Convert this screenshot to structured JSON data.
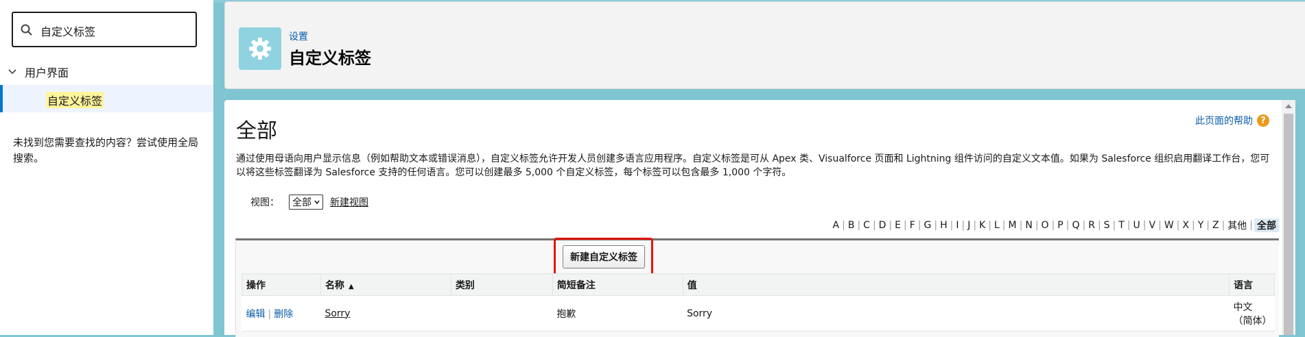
{
  "sidebar": {
    "search_value": "自定义标签",
    "tree_parent": "用户界面",
    "tree_child": "自定义标签",
    "not_found": "未找到您需要查找的内容？尝试使用全局搜索。"
  },
  "header": {
    "breadcrumb": "设置",
    "title": "自定义标签"
  },
  "main": {
    "heading": "全部",
    "help_link": "此页面的帮助",
    "help_icon": "?",
    "description": "通过使用母语向用户显示信息（例如帮助文本或错误消息），自定义标签允许开发人员创建多语言应用程序。自定义标签是可从 Apex 类、Visualforce 页面和 Lightning 组件访问的自定义文本值。如果为 Salesforce 组织启用翻译工作台，您可以将这些标签翻译为 Salesforce 支持的任何语言。您可以创建最多 5,000 个自定义标签，每个标签可以包含最多 1,000 个字符。",
    "view_label": "视图：",
    "view_selected": "全部",
    "new_view": "新建视图",
    "new_button": "新建自定义标签"
  },
  "alphabet": [
    "A",
    "B",
    "C",
    "D",
    "E",
    "F",
    "G",
    "H",
    "I",
    "J",
    "K",
    "L",
    "M",
    "N",
    "O",
    "P",
    "Q",
    "R",
    "S",
    "T",
    "U",
    "V",
    "W",
    "X",
    "Y",
    "Z",
    "其他",
    "全部"
  ],
  "alphabet_active": "全部",
  "table": {
    "columns": [
      "操作",
      "名称",
      "类别",
      "简短备注",
      "值",
      "语言"
    ],
    "rows": [
      {
        "edit": "编辑",
        "delete": "删除",
        "name": "Sorry",
        "category": "",
        "short_note": "抱歉",
        "value": "Sorry",
        "language": "中文（简体）"
      }
    ]
  },
  "colors": {
    "accent": "#0176d3",
    "link": "#0b5cab",
    "header_icon_bg": "#8fd3e1",
    "highlight": "#e0140d"
  }
}
